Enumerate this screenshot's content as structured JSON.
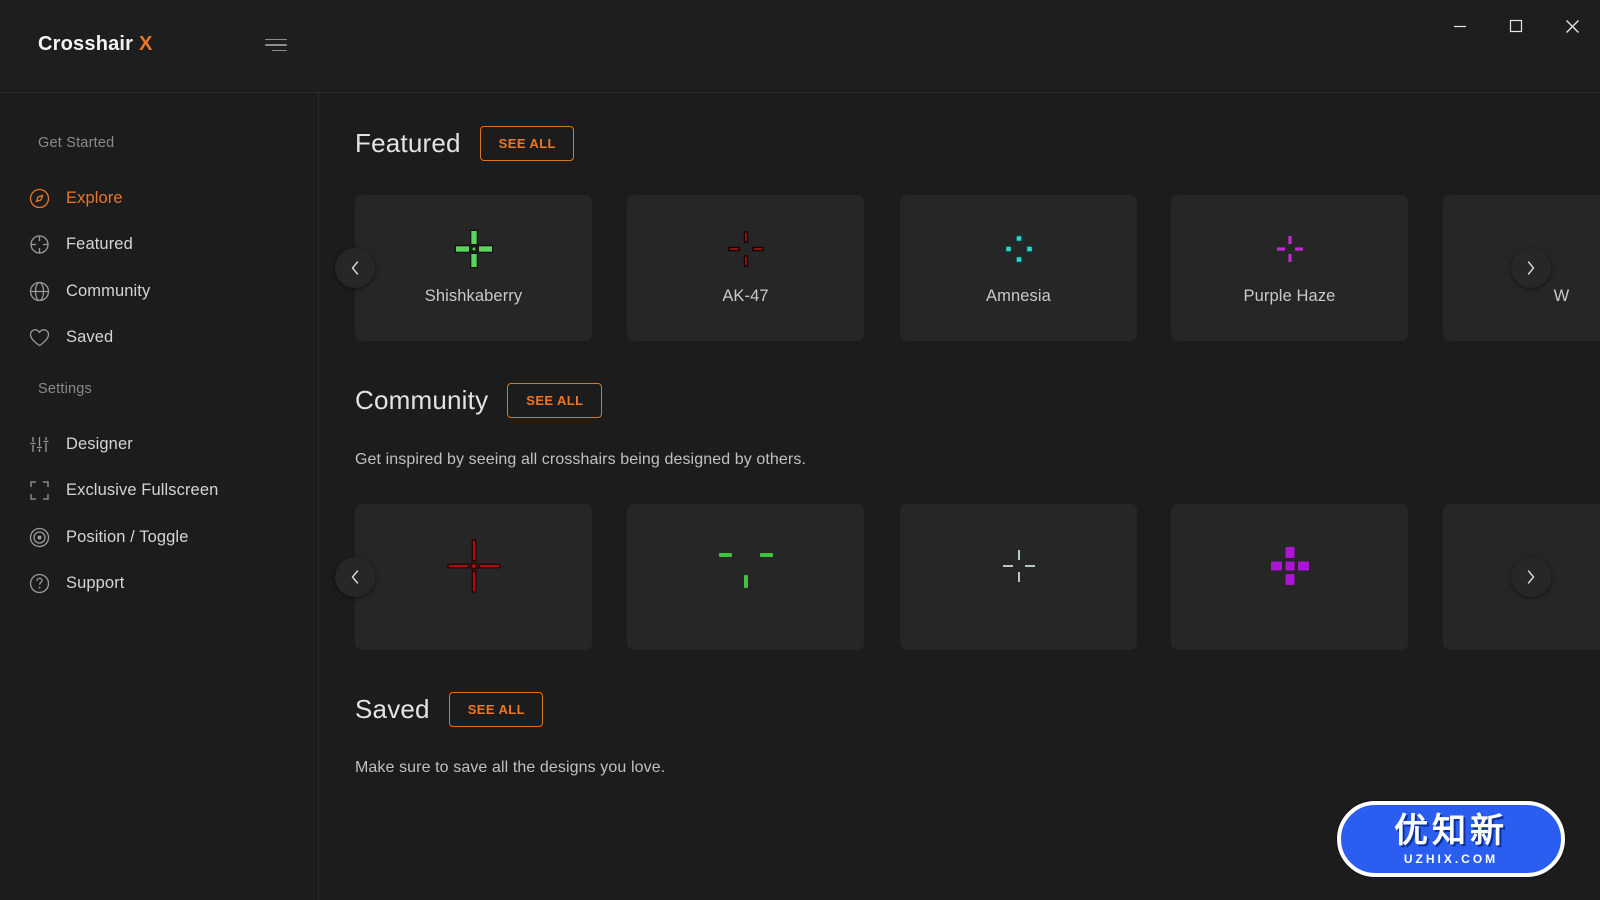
{
  "window": {
    "title": "Crosshair X",
    "brand_main": "Crosshair",
    "brand_accent": "X",
    "accent_color": "#e8762b",
    "background": "#1c1c1c",
    "menu_icon": "hamburger-icon",
    "controls": {
      "minimize": "minimize-icon",
      "maximize": "maximize-icon",
      "close": "close-icon"
    }
  },
  "sidebar": {
    "groups": [
      {
        "label": "Get Started",
        "items": [
          {
            "label": "Explore",
            "icon": "compass-icon",
            "active": true
          },
          {
            "label": "Featured",
            "icon": "crosshair-icon",
            "active": false
          },
          {
            "label": "Community",
            "icon": "globe-icon",
            "active": false
          },
          {
            "label": "Saved",
            "icon": "heart-icon",
            "active": false
          }
        ]
      },
      {
        "label": "Settings",
        "items": [
          {
            "label": "Designer",
            "icon": "sliders-icon",
            "active": false
          },
          {
            "label": "Exclusive Fullscreen",
            "icon": "fullscreen-icon",
            "active": false
          },
          {
            "label": "Position / Toggle",
            "icon": "target-icon",
            "active": false
          },
          {
            "label": "Support",
            "icon": "help-icon",
            "active": false
          }
        ]
      }
    ]
  },
  "main": {
    "sections": [
      {
        "title": "Featured",
        "see_all_label": "SEE ALL",
        "subtitle": "",
        "prev_icon": "chevron-left-icon",
        "next_icon": "chevron-right-icon",
        "cards": [
          {
            "name": "Shishkaberry",
            "crosshair": "thick-cross",
            "color": "#5bd45b"
          },
          {
            "name": "AK-47",
            "crosshair": "gap-cross",
            "color": "#d32020"
          },
          {
            "name": "Amnesia",
            "crosshair": "dot-diamond",
            "color": "#2fd6cb"
          },
          {
            "name": "Purple Haze",
            "crosshair": "small-cross",
            "color": "#c02ad0"
          },
          {
            "name": "W",
            "crosshair": "none",
            "color": "#cccccc"
          }
        ]
      },
      {
        "title": "Community",
        "see_all_label": "SEE ALL",
        "subtitle": "Get inspired by seeing all crosshairs being designed by others.",
        "prev_icon": "chevron-left-icon",
        "next_icon": "chevron-right-icon",
        "cards": [
          {
            "name": "",
            "crosshair": "thin-cross-dot",
            "color": "#cc1111"
          },
          {
            "name": "",
            "crosshair": "three-dash",
            "color": "#3ec43e"
          },
          {
            "name": "",
            "crosshair": "thin-cross",
            "color": "#d8f0ec"
          },
          {
            "name": "",
            "crosshair": "block-cross",
            "color": "#b414e0"
          },
          {
            "name": "",
            "crosshair": "none",
            "color": "#cccccc"
          }
        ]
      },
      {
        "title": "Saved",
        "see_all_label": "SEE ALL",
        "subtitle": "Make sure to save all the designs you love.",
        "prev_icon": "",
        "next_icon": "",
        "cards": []
      }
    ]
  },
  "watermark": {
    "text_cn": "优知新",
    "text_domain": "UZHIX.COM",
    "color": "#2a5ef0"
  }
}
